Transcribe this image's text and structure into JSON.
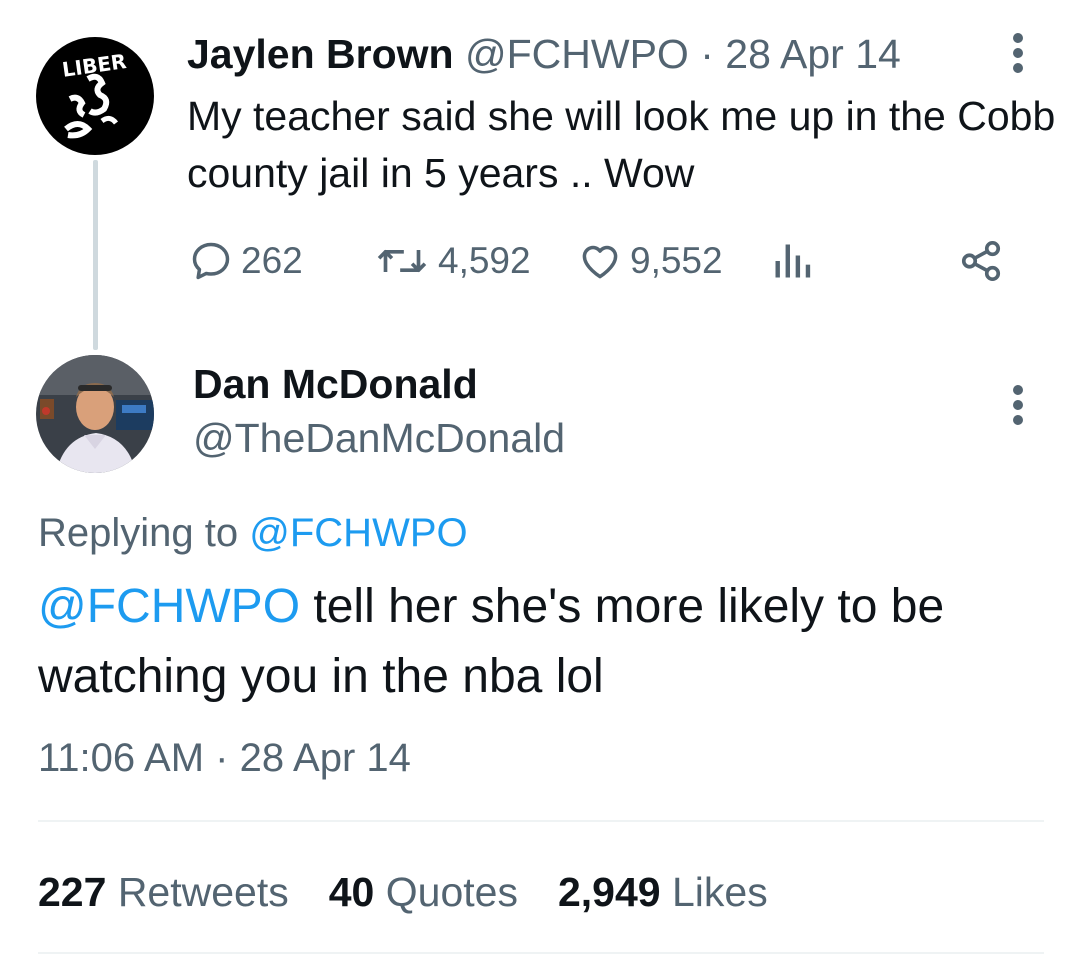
{
  "parent_tweet": {
    "avatar_icon": "liberty-logo-avatar",
    "avatar_text": "LIBER",
    "author_name": "Jaylen Brown",
    "author_handle": "@FCHWPO",
    "separator": "·",
    "date": "28 Apr 14",
    "text": "My teacher said she will look me up in the Cobb county jail in 5 years .. Wow",
    "actions": {
      "reply_count": "262",
      "retweet_count": "4,592",
      "like_count": "9,552",
      "reply_icon": "reply-bubble-icon",
      "retweet_icon": "retweet-icon",
      "like_icon": "heart-icon",
      "views_icon": "views-bar-chart-icon",
      "share_icon": "share-icon"
    }
  },
  "reply_tweet": {
    "avatar_icon": "profile-photo-avatar",
    "author_name": "Dan McDonald",
    "author_handle": "@TheDanMcDonald",
    "replying_to_prefix": "Replying to",
    "replying_to_handle": "@FCHWPO",
    "mention": "@FCHWPO",
    "text": " tell her she's more likely to be watching you in the nba lol",
    "time": "11:06 AM",
    "separator": "·",
    "date": "28 Apr 14",
    "stats": {
      "retweets_count": "227",
      "retweets_label": "Retweets",
      "quotes_count": "40",
      "quotes_label": "Quotes",
      "likes_count": "2,949",
      "likes_label": "Likes"
    }
  },
  "colors": {
    "text_primary": "#0f1419",
    "text_secondary": "#536471",
    "link": "#1d9bf0",
    "divider": "#eff3f4",
    "thread_line": "#cfd9de"
  }
}
